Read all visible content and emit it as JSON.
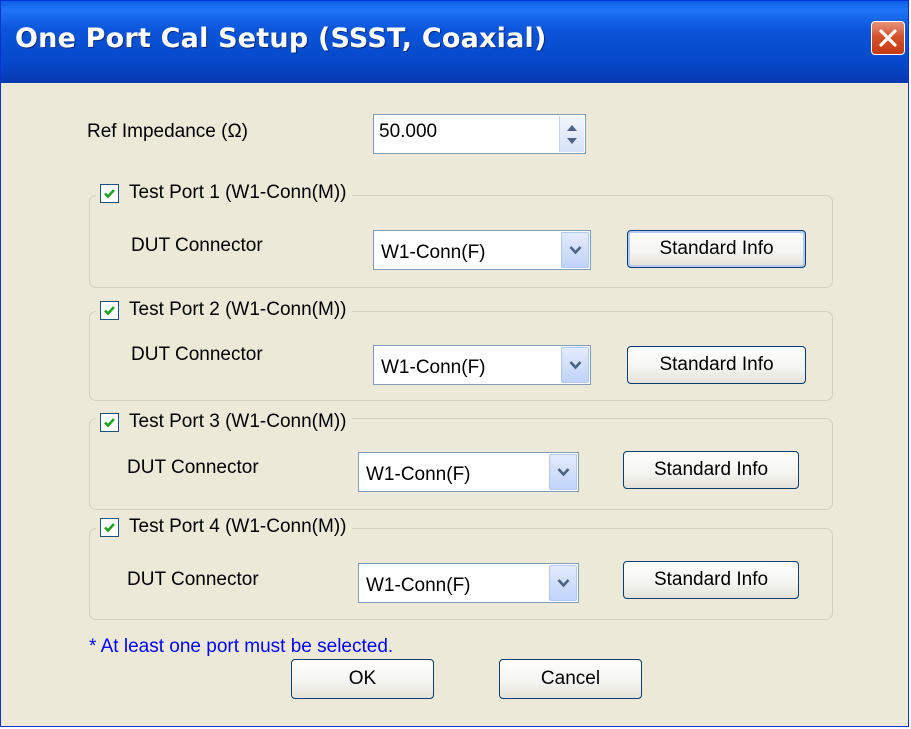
{
  "window": {
    "title": "One Port Cal Setup (SSST, Coaxial)"
  },
  "ref_impedance": {
    "label": "Ref Impedance (Ω)",
    "value": "50.000"
  },
  "ports": [
    {
      "label": "Test Port 1 (W1-Conn(M))",
      "checked": true,
      "connector_label": "DUT Connector",
      "connector_value": "W1-Conn(F)",
      "button": "Standard Info"
    },
    {
      "label": "Test Port 2 (W1-Conn(M))",
      "checked": true,
      "connector_label": "DUT Connector",
      "connector_value": "W1-Conn(F)",
      "button": "Standard Info"
    },
    {
      "label": "Test Port 3 (W1-Conn(M))",
      "checked": true,
      "connector_label": "DUT Connector",
      "connector_value": "W1-Conn(F)",
      "button": "Standard Info"
    },
    {
      "label": "Test Port 4 (W1-Conn(M))",
      "checked": true,
      "connector_label": "DUT Connector",
      "connector_value": "W1-Conn(F)",
      "button": "Standard Info"
    }
  ],
  "note": "* At least one port must be selected.",
  "buttons": {
    "ok": "OK",
    "cancel": "Cancel"
  },
  "colors": {
    "title_bar": "#0a55de",
    "close": "#d5532c",
    "dialog_bg": "#ece9d8",
    "note": "#0000ff",
    "check": "#21a121"
  },
  "icons": {
    "close": "close-icon",
    "checkbox": "checkmark-icon",
    "dropdown": "chevron-down-icon",
    "spinner": "spinner-arrows-icon"
  }
}
